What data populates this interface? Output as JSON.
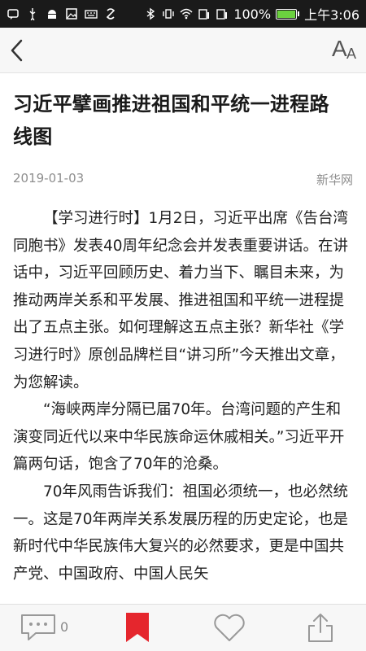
{
  "status_bar": {
    "battery_percent": "100%",
    "battery_level": 1.0,
    "time": "上午3:06",
    "battery_color": "#6bd13f"
  },
  "navbar": {
    "back_icon": "chevron-left-icon",
    "font_icon": "font-size-icon"
  },
  "article": {
    "title": "习近平擘画推进祖国和平统一进程路线图",
    "date": "2019-01-03",
    "source": "新华网",
    "paragraphs": [
      "【学习进行时】1月2日，习近平出席《告台湾同胞书》发表40周年纪念会并发表重要讲话。在讲话中，习近平回顾历史、着力当下、瞩目未来，为推动两岸关系和平发展、推进祖国和平统一进程提出了五点主张。如何理解这五点主张？新华社《学习进行时》原创品牌栏目“讲习所”今天推出文章，为您解读。",
      "“海峡两岸分隔已届70年。台湾问题的产生和演变同近代以来中华民族命运休戚相关。”习近平开篇两句话，饱含了70年的沧桑。",
      "70年风雨告诉我们：祖国必须统一，也必然统一。这是70年两岸关系发展历程的历史定论，也是新时代中华民族伟大复兴的必然要求，更是中国共产党、中国政府、中国人民矢"
    ]
  },
  "bottom_bar": {
    "comment_count": "0",
    "bookmark_color": "#e5262d"
  }
}
